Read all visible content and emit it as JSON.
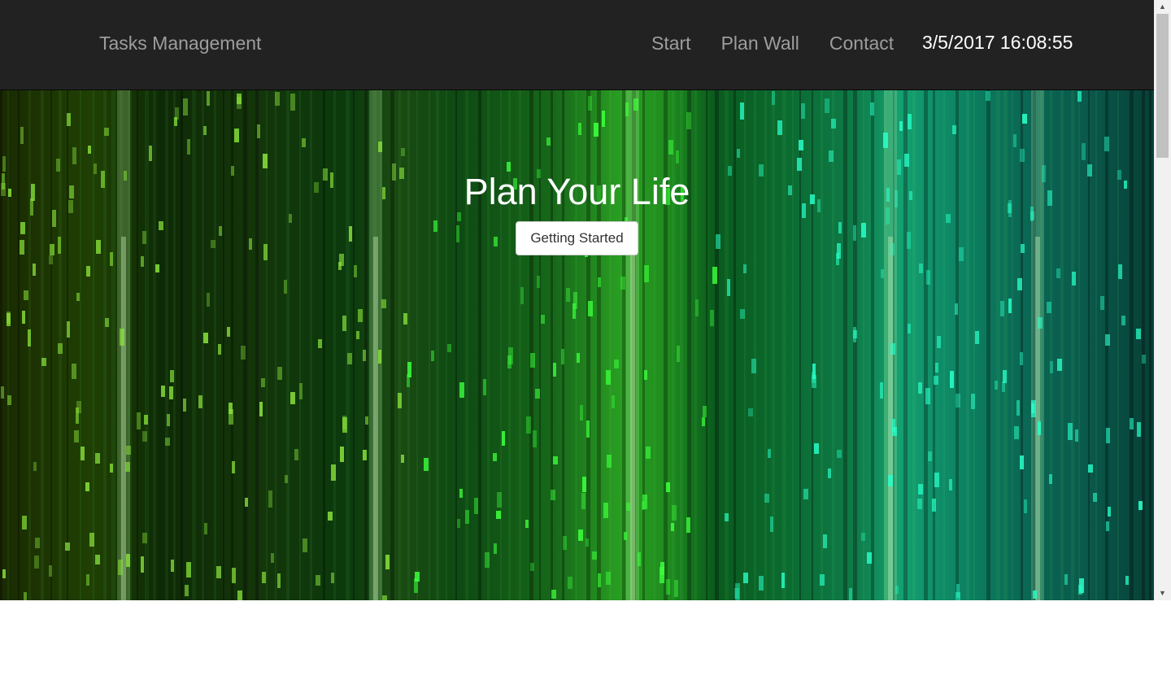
{
  "navbar": {
    "brand": "Tasks Management",
    "links": [
      "Start",
      "Plan Wall",
      "Contact"
    ],
    "clock": "3/5/2017 16:08:55",
    "background_color": "#222222",
    "link_color": "#9d9d9d"
  },
  "hero": {
    "title": "Plan Your Life",
    "button_label": "Getting Started",
    "background_image": "green-digital-rain-streaks"
  },
  "scrollbar": {
    "up_icon": "triangle-up-icon",
    "down_icon": "triangle-down-icon"
  }
}
